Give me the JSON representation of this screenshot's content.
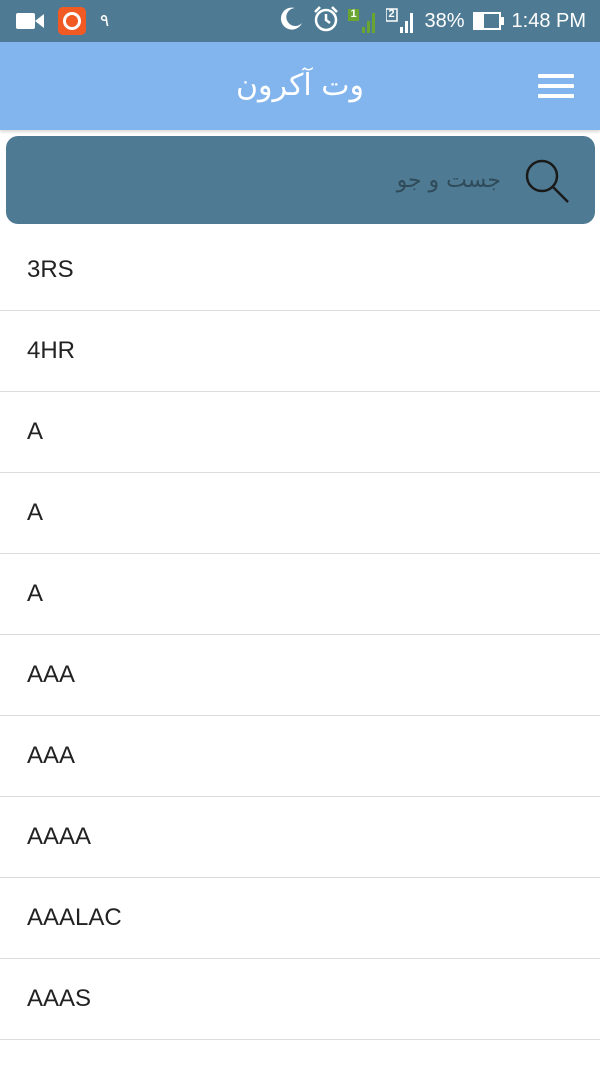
{
  "status_bar": {
    "notification_count": "٩",
    "battery_percent": "38%",
    "battery_level": 0.38,
    "sim1_label": "1",
    "sim2_label": "2",
    "time": "1:48 PM",
    "icons": [
      "video-camera-icon",
      "app-notification-icon",
      "moon-icon",
      "alarm-icon",
      "signal-sim1-icon",
      "signal-sim2-icon",
      "battery-icon"
    ]
  },
  "app_bar": {
    "title": "وت آکرون",
    "menu_icon": "hamburger-menu-icon"
  },
  "search": {
    "placeholder": "جست و جو",
    "icon": "search-icon"
  },
  "colors": {
    "status_bar": "#4e7b93",
    "app_bar": "#82b5ed",
    "search_box": "#4e7b93",
    "list_background": "#ffffff",
    "divider": "#dcdcdc"
  },
  "list": {
    "items": [
      "3RS",
      "4HR",
      "A",
      "A",
      "A",
      "AAA",
      "AAA",
      "AAAA",
      "AAALAC",
      "AAAS"
    ]
  }
}
